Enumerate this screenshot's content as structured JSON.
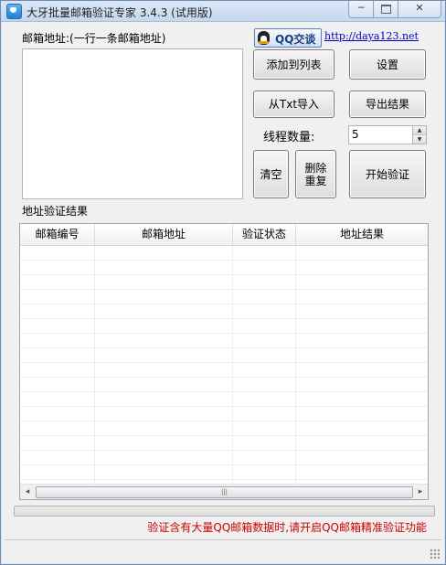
{
  "window": {
    "title": "大牙批量邮箱验证专家 3.4.3 (试用版)",
    "minimize_label": "─",
    "close_label": "✕"
  },
  "email_input": {
    "label": "邮箱地址:(一行一条邮箱地址)",
    "value": ""
  },
  "qq_chat_button": {
    "label": "QQ交谈"
  },
  "website_link": {
    "text": "http://daya123.net"
  },
  "buttons": {
    "add_to_list": "添加到列表",
    "settings": "设置",
    "import_txt": "从Txt导入",
    "export_results": "导出结果",
    "clear": "清空",
    "remove_dup_line1": "删除",
    "remove_dup_line2": "重复",
    "start_verify": "开始验证"
  },
  "thread_count": {
    "label": "线程数量:",
    "value": "5"
  },
  "results": {
    "section_label": "地址验证结果",
    "columns": [
      "邮箱编号",
      "邮箱地址",
      "验证状态",
      "地址结果"
    ],
    "rows": []
  },
  "scrollbar": {
    "thumb_grip": "|||",
    "left_arrow": "◂",
    "right_arrow": "▸"
  },
  "progress": {
    "value": 0
  },
  "notice": "验证含有大量QQ邮箱数据时,请开启QQ邮箱精准验证功能",
  "colors": {
    "notice": "#cc0000",
    "link": "#0000cc"
  }
}
